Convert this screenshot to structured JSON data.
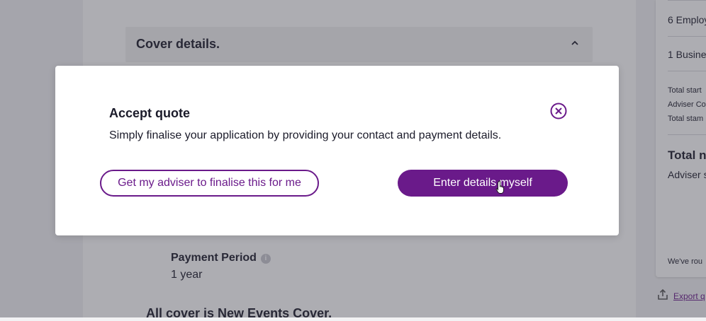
{
  "background": {
    "cover_section_title": "Cover details.",
    "payment_period_label": "Payment Period",
    "payment_period_value": "1 year",
    "all_cover_text": "All cover is New Events Cover.",
    "summary": {
      "employees": "6 Employ",
      "business": "1 Busine",
      "total_start": "Total start",
      "adviser_co": "Adviser Co",
      "total_stam": "Total stam",
      "total_heading": "Total n",
      "adviser_s": "Adviser s",
      "footer_text": "We've rou"
    },
    "export_link": "Export q"
  },
  "modal": {
    "title": "Accept quote",
    "body": "Simply finalise your application by providing your contact and payment details.",
    "adviser_button": "Get my adviser to finalise this for me",
    "self_button": "Enter details myself"
  },
  "colors": {
    "brand": "#6a1a8a",
    "overlay": "rgba(60,60,72,0.42)"
  },
  "icons": [
    "chevron-up-icon",
    "info-icon",
    "export-icon",
    "close-circle-icon",
    "hand-pointer-cursor"
  ]
}
